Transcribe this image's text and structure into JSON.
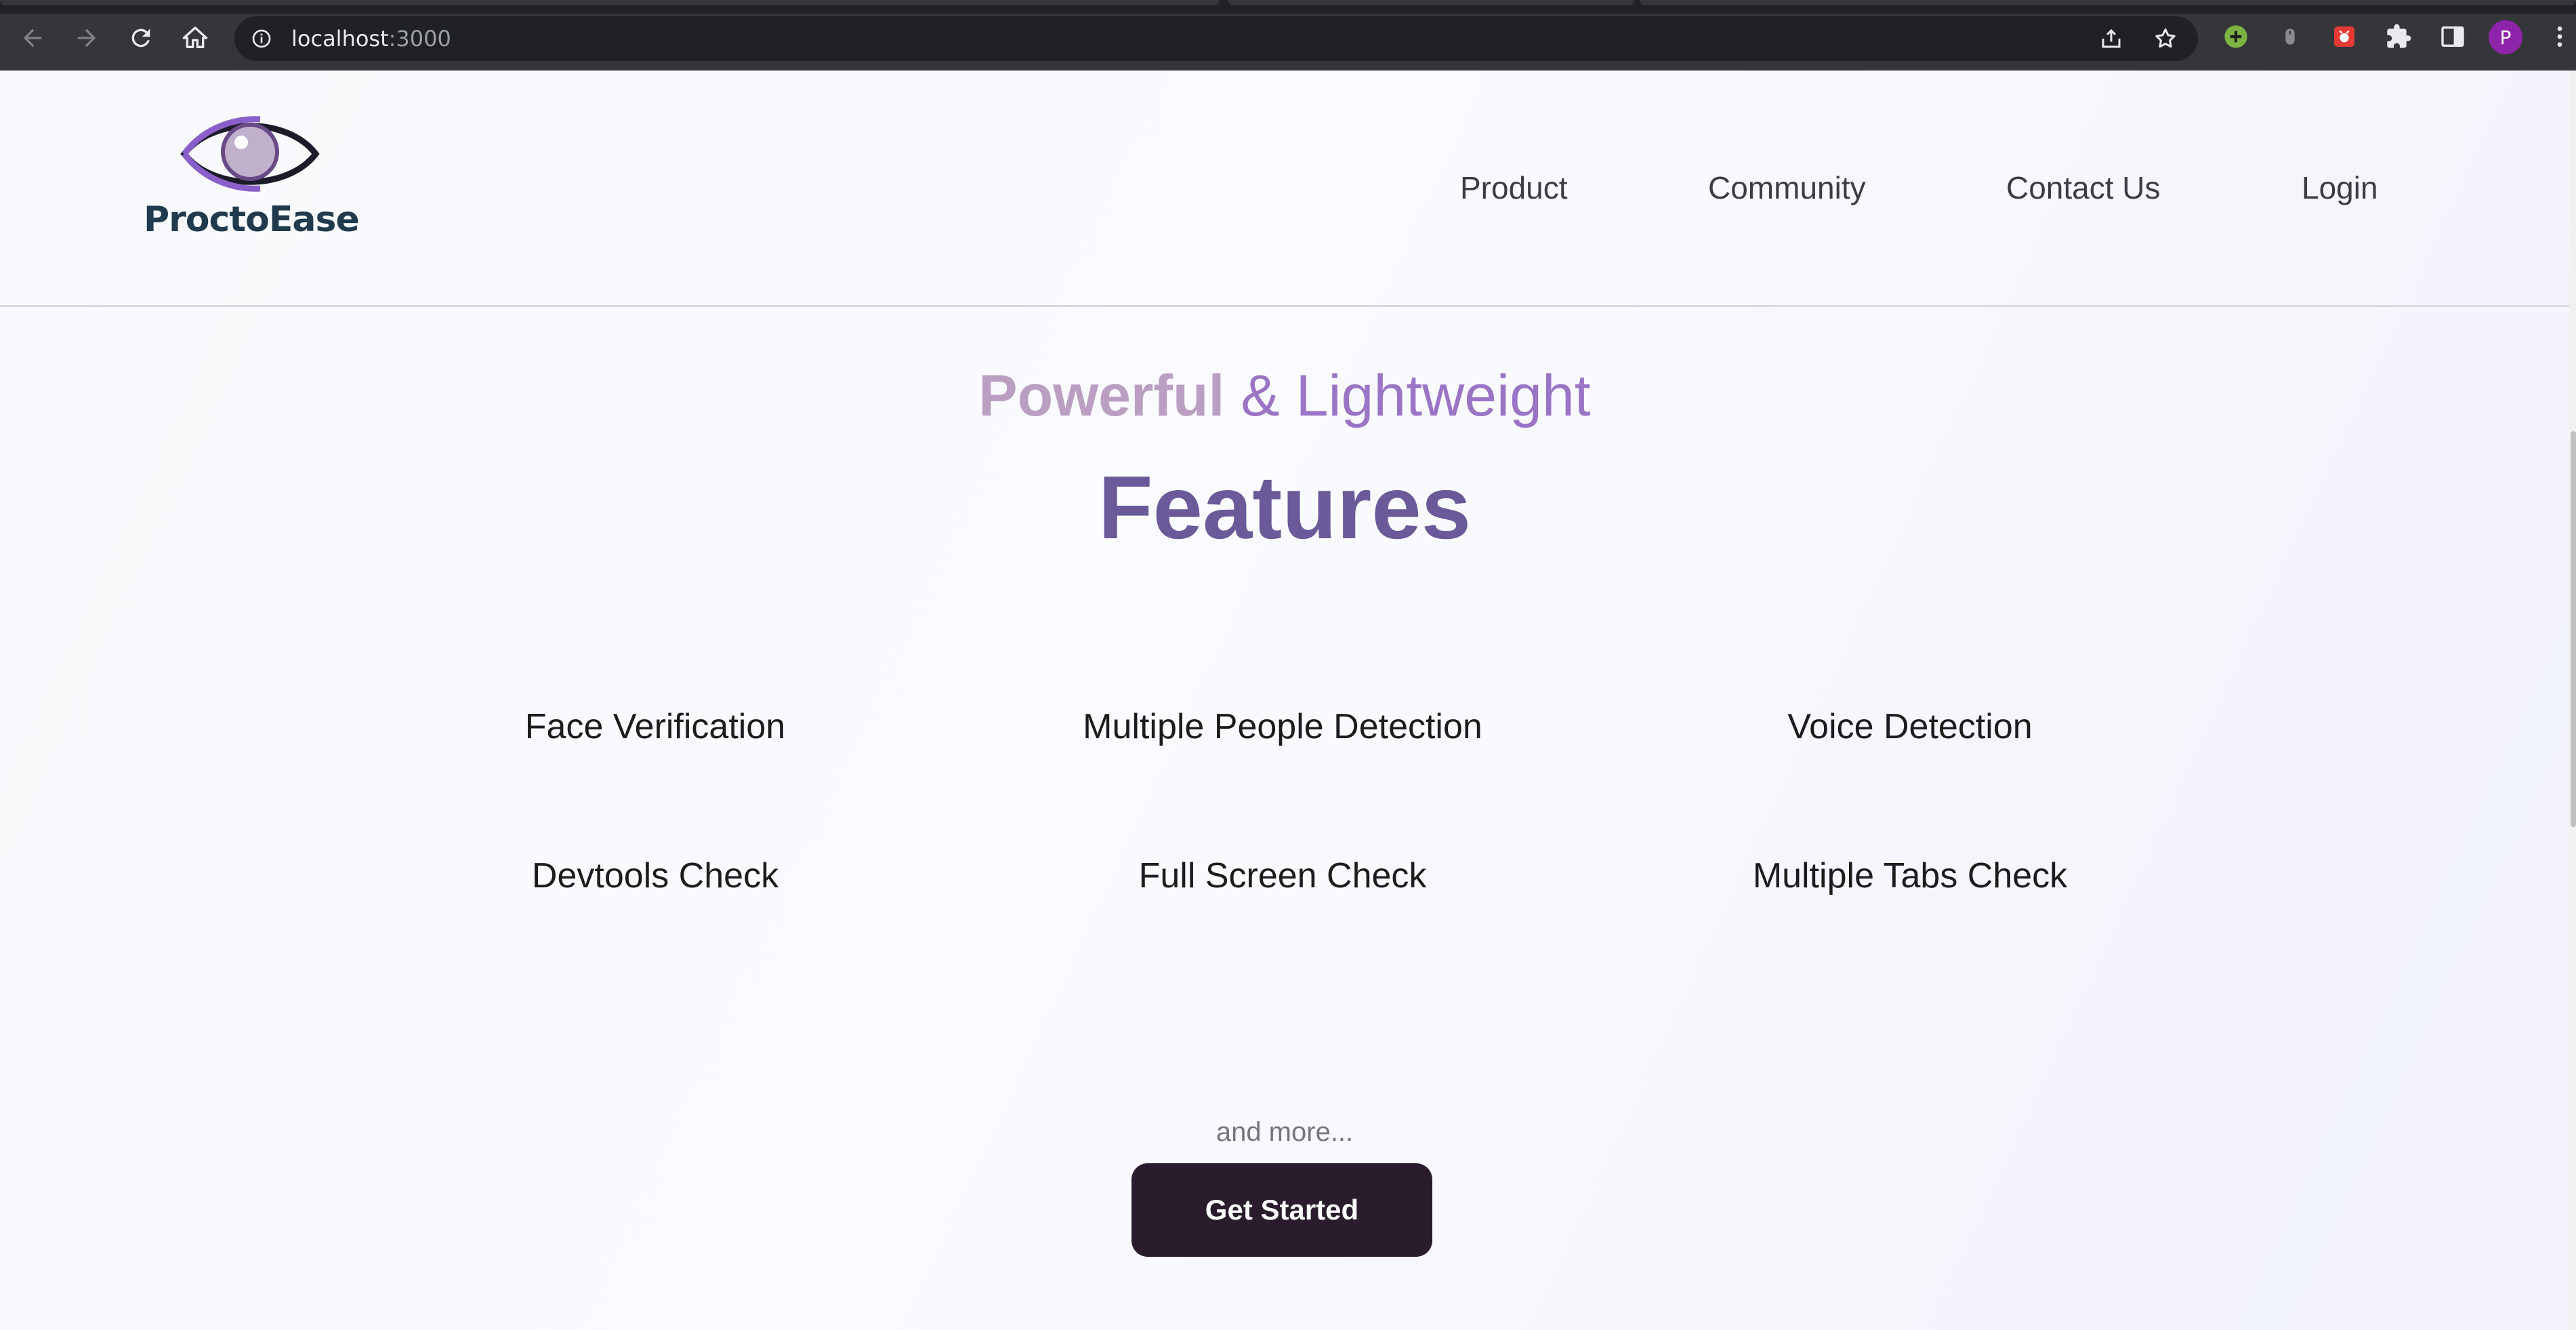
{
  "browser": {
    "url_host": "localhost",
    "url_port": ":3000",
    "profile_initial": "P"
  },
  "site": {
    "brand": "ProctoEase",
    "nav": [
      "Product",
      "Community",
      "Contact Us",
      "Login"
    ]
  },
  "hero": {
    "eyebrow_strong": "Powerful",
    "eyebrow_light": "& Lightweight",
    "title": "Features"
  },
  "features": [
    "Face Verification",
    "Multiple People Detection",
    "Voice Detection",
    "Devtools Check",
    "Full Screen Check",
    "Multiple Tabs Check"
  ],
  "more_text": "and more...",
  "cta_label": "Get Started",
  "colors": {
    "eyebrow_strong": "#bb9fc2",
    "eyebrow_light": "#9b74c6",
    "title": "#6a5a9a",
    "cta_bg": "#2a1b2d",
    "brand_text": "#1f3b4d"
  },
  "icons": {
    "back": "arrow-left-icon",
    "forward": "arrow-right-icon",
    "reload": "reload-icon",
    "home": "home-icon",
    "site_info": "info-icon",
    "share": "share-icon",
    "bookmark": "star-icon",
    "extensions": "puzzle-icon",
    "side_panel": "side-panel-icon",
    "menu": "kebab-menu-icon"
  }
}
